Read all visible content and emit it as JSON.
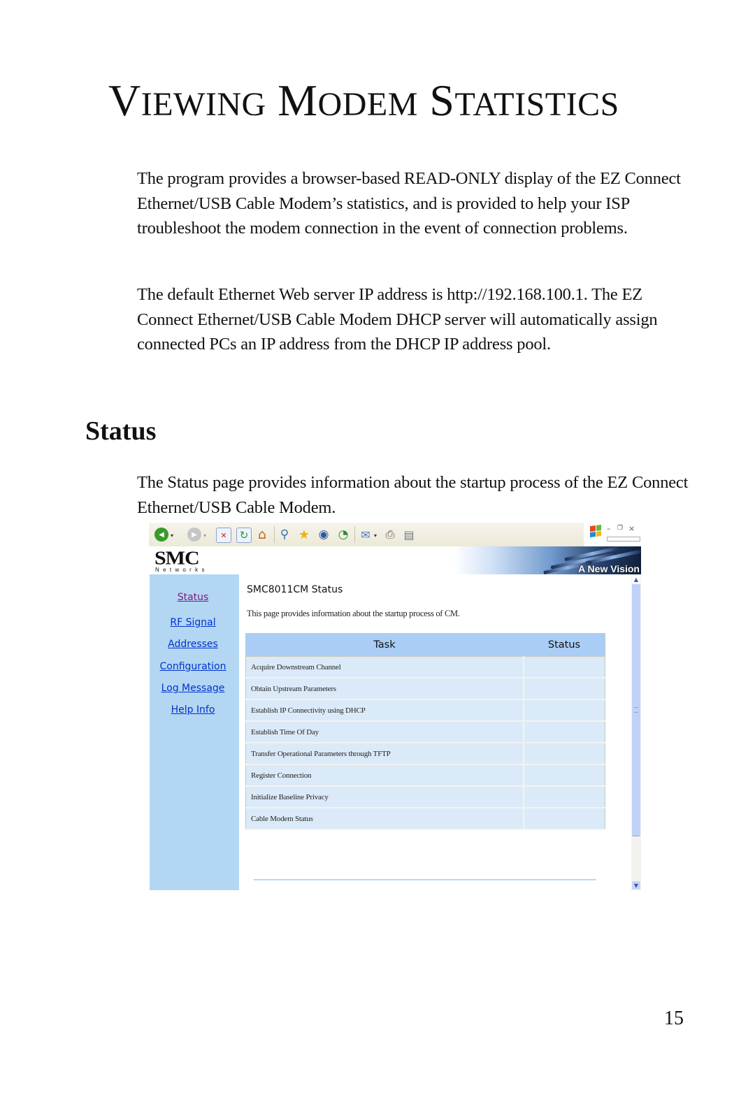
{
  "document": {
    "chapter_title": {
      "lead1": "V",
      "rest1": "IEWING",
      "lead2": "M",
      "rest2": "ODEM",
      "lead3": "S",
      "rest3": "TATISTICS"
    },
    "intro_paragraph_1": "The program provides a browser-based READ-ONLY display of the EZ Connect Ethernet/USB Cable Modem’s statistics, and is provided to help your ISP troubleshoot the modem connection in the event of connection problems.",
    "intro_paragraph_2": "The default Ethernet Web server IP address is http://192.168.100.1. The EZ Connect Ethernet/USB Cable Modem DHCP server will automatically assign connected PCs an IP address from the DHCP IP address pool.",
    "section_title": "Status",
    "section_paragraph": "The Status page provides information about the startup process of the EZ Connect Ethernet/USB Cable Modem.",
    "page_number": "15"
  },
  "screenshot": {
    "toolbar": {
      "icons": [
        "back-icon",
        "forward-icon",
        "stop-icon",
        "refresh-icon",
        "home-icon",
        "search-icon",
        "favorites-icon",
        "media-icon",
        "history-icon",
        "mail-icon",
        "print-icon",
        "edit-icon"
      ],
      "glyphs": {
        "back": "◀",
        "forward": "▶",
        "stop": "✕",
        "refresh": "↻",
        "home": "⌂",
        "search": "⚲",
        "favorites": "★",
        "media": "◉",
        "history": "◔",
        "mail": "✉",
        "print": "⎙",
        "edit": "▤",
        "dropdown": "▾"
      }
    },
    "window_controls": {
      "minimize": "–",
      "restore": "❐",
      "close": "×"
    },
    "banner": {
      "logo": "SMC",
      "logo_sub": "Networks",
      "tagline": "A New Vision"
    },
    "sidebar": {
      "items": [
        {
          "label": "Status",
          "visited": true
        },
        {
          "label": "RF Signal"
        },
        {
          "label": "Addresses"
        },
        {
          "label": "Configuration"
        },
        {
          "label": "Log Message"
        },
        {
          "label": "Help Info"
        }
      ]
    },
    "content": {
      "heading": "SMC8011CM Status",
      "description": "This page provides information about the startup process of CM.",
      "table": {
        "headers": [
          "Task",
          "Status"
        ],
        "rows": [
          {
            "task": "Acquire Downstream Channel",
            "status": ""
          },
          {
            "task": "Obtain Upstream Parameters",
            "status": ""
          },
          {
            "task": "Establish IP Connectivity using DHCP",
            "status": ""
          },
          {
            "task": "Establish Time Of Day",
            "status": ""
          },
          {
            "task": "Transfer Operational Parameters through TFTP",
            "status": ""
          },
          {
            "task": "Register Connection",
            "status": ""
          },
          {
            "task": "Initialize Baseline Privacy",
            "status": ""
          },
          {
            "task": "Cable Modem Status",
            "status": ""
          }
        ]
      }
    },
    "scrollbar": {
      "up": "▲",
      "down": "▼"
    },
    "colors": {
      "sidebar_bg": "#b3d6f3",
      "table_header_bg": "#a9cdf5",
      "table_row_bg": "#dbeaf8",
      "link": "#0033cc",
      "visited_link": "#7a1a7e"
    }
  }
}
